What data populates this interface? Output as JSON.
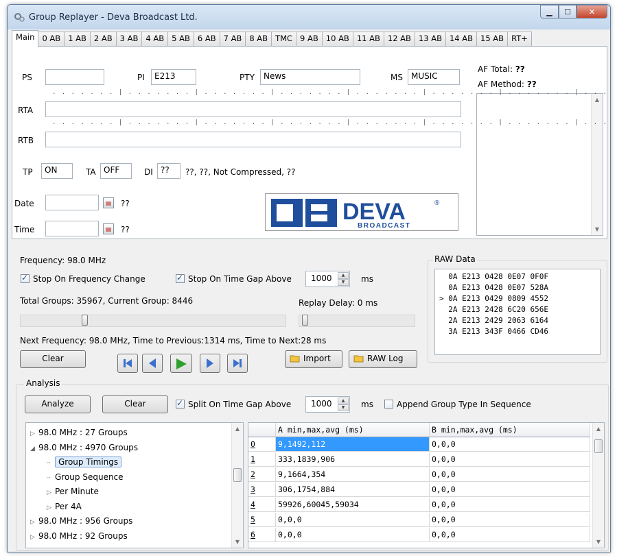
{
  "window": {
    "title": "Group Replayer - Deva Broadcast Ltd.",
    "minimize": "▁",
    "maximize": "☐",
    "close": "✕"
  },
  "tabs": [
    "Main",
    "0 AB",
    "1 AB",
    "2 AB",
    "3 AB",
    "4 AB",
    "5 AB",
    "6 AB",
    "7 AB",
    "8 AB",
    "TMC",
    "9 AB",
    "10 AB",
    "11 AB",
    "12 AB",
    "13 AB",
    "14 AB",
    "15 AB",
    "RT+"
  ],
  "main": {
    "ps_label": "PS",
    "ps_value": "",
    "pi_label": "PI",
    "pi_value": "E213",
    "pty_label": "PTY",
    "pty_value": "News",
    "ms_label": "MS",
    "ms_value": "MUSIC",
    "ruler": ". . . . . . . | . . . . . . . | . . . . . . . | . . . . . . . | . . . . . . . | . . . . . . . | . . . . . . . | . . . . . . . |",
    "rta_label": "RTA",
    "rta_value": "",
    "rtb_label": "RTB",
    "rtb_value": "",
    "tp_label": "TP",
    "tp_value": "ON",
    "ta_label": "TA",
    "ta_value": "OFF",
    "di_label": "DI",
    "di_value": "??",
    "di_text": "??, ??, Not Compressed, ??",
    "date_label": "Date",
    "date_value": "",
    "date_text": "??",
    "time_label": "Time",
    "time_value": "",
    "time_text": "??",
    "af_total_label": "AF Total:",
    "af_total_value": "??",
    "af_method_label": "AF Method:",
    "af_method_value": "??",
    "logo_text": "DEVA",
    "logo_sub": "BROADCAST",
    "logo_reg": "®"
  },
  "replay": {
    "frequency": "Frequency: 98.0 MHz",
    "stop_freq_label": "Stop On Frequency Change",
    "stop_freq_checked": true,
    "stop_gap_label": "Stop On Time Gap Above",
    "stop_gap_checked": true,
    "gap_value": "1000",
    "gap_unit": "ms",
    "totals": "Total Groups: 35967, Current Group: 8446",
    "replay_delay": "Replay Delay: 0 ms",
    "position_fraction": 0.235,
    "delay_fraction": 0.0,
    "next_info": "Next Frequency: 98.0 MHz, Time to Previous:1314 ms, Time to Next:28 ms",
    "clear_label": "Clear",
    "import_label": "Import",
    "rawlog_label": "RAW Log"
  },
  "raw": {
    "title": "RAW Data",
    "lines": [
      "  0A E213 0428 0E07 0F0F",
      "  0A E213 0428 0E07 528A",
      "> 0A E213 0429 0809 4552",
      "  2A E213 2428 6C20 656E",
      "  2A E213 2429 2063 6164",
      "  3A E213 343F 0466 CD46"
    ]
  },
  "analysis": {
    "title": "Analysis",
    "analyze_label": "Analyze",
    "clear_label": "Clear",
    "split_label": "Split On Time Gap Above",
    "split_checked": true,
    "split_value": "1000",
    "split_unit": "ms",
    "append_label": "Append Group Type In Sequence",
    "append_checked": false,
    "tree": [
      {
        "text": "98.0 MHz : 27 Groups",
        "arrow": "▷",
        "level": 0
      },
      {
        "text": "98.0 MHz : 4970 Groups",
        "arrow": "◢",
        "level": 0
      },
      {
        "text": "Group Timings",
        "arrow": "",
        "level": 1,
        "selected": true
      },
      {
        "text": "Group Sequence",
        "arrow": "",
        "level": 1
      },
      {
        "text": "Per Minute",
        "arrow": "▷",
        "level": 1
      },
      {
        "text": "Per 4A",
        "arrow": "▷",
        "level": 1
      },
      {
        "text": "98.0 MHz : 956 Groups",
        "arrow": "▷",
        "level": 0
      },
      {
        "text": "98.0 MHz : 92 Groups",
        "arrow": "▷",
        "level": 0
      }
    ],
    "grid_headers": [
      "A min,max,avg (ms)",
      "B min,max,avg (ms)"
    ],
    "grid_rows": [
      {
        "idx": "0",
        "a": "9,1492,112",
        "b": "0,0,0"
      },
      {
        "idx": "1",
        "a": "333,1839,906",
        "b": "0,0,0"
      },
      {
        "idx": "2",
        "a": "9,1664,354",
        "b": "0,0,0"
      },
      {
        "idx": "3",
        "a": "306,1754,884",
        "b": "0,0,0"
      },
      {
        "idx": "4",
        "a": "59926,60045,59034",
        "b": "0,0,0"
      },
      {
        "idx": "5",
        "a": "0,0,0",
        "b": "0,0,0"
      },
      {
        "idx": "6",
        "a": "0,0,0",
        "b": "0,0,0"
      }
    ]
  },
  "colors": {
    "accent": "#3399ff",
    "logo": "#1f4e9c",
    "play": "#2e9e2e",
    "nav": "#3a6fd0"
  }
}
